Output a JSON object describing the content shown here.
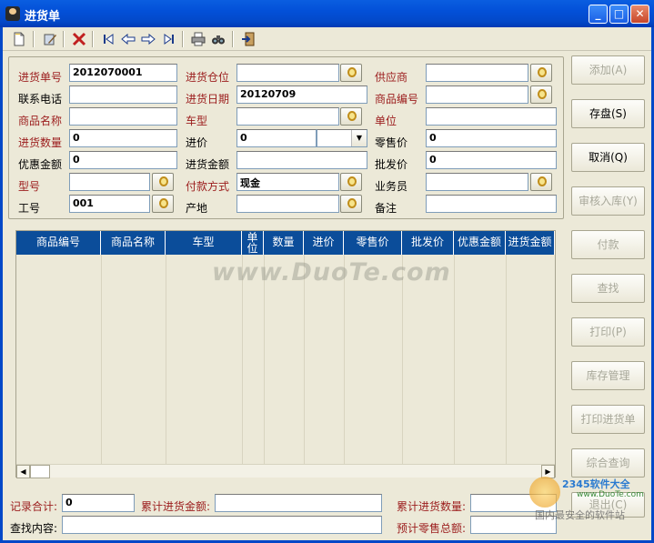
{
  "window": {
    "title": "进货单",
    "minimize": "_",
    "maximize": "□",
    "close": "✕"
  },
  "toolbar": {
    "icons": [
      "new-icon",
      "edit-icon",
      "delete-icon",
      "first-icon",
      "prev-icon",
      "next-icon",
      "last-icon",
      "print-icon",
      "find-icon",
      "exit-icon"
    ]
  },
  "form": {
    "order_no_label": "进货单号",
    "order_no": "2012070001",
    "warehouse_label": "进货仓位",
    "warehouse": "",
    "supplier_label": "供应商",
    "supplier": "",
    "phone_label": "联系电话",
    "phone": "",
    "date_label": "进货日期",
    "date": "20120709",
    "product_code_label": "商品编号",
    "product_code": "",
    "product_name_label": "商品名称",
    "product_name": "",
    "model_label": "车型",
    "model": "",
    "unit_label": "单位",
    "unit": "",
    "qty_label": "进货数量",
    "qty": "0",
    "price_label": "进价",
    "price": "0",
    "retail_label": "零售价",
    "retail": "0",
    "discount_label": "优惠金额",
    "discount": "0",
    "amount_label": "进货金额",
    "amount": "",
    "wholesale_label": "批发价",
    "wholesale": "0",
    "type_label": "型号",
    "type": "",
    "payment_label": "付款方式",
    "payment": "现金",
    "salesman_label": "业务员",
    "salesman": "",
    "worker_label": "工号",
    "worker": "001",
    "origin_label": "产地",
    "origin": "",
    "remark_label": "备注",
    "remark": ""
  },
  "grid": {
    "columns": [
      "商品编号",
      "商品名称",
      "车型",
      "单位",
      "数量",
      "进价",
      "零售价",
      "批发价",
      "优惠金额",
      "进货金额"
    ]
  },
  "actions": {
    "add": "添加(A)",
    "save": "存盘(S)",
    "cancel": "取消(Q)",
    "audit": "审核入库(Y)",
    "pay": "付款",
    "search": "查找",
    "print": "打印(P)",
    "stock": "库存管理",
    "print_order": "打印进货单",
    "query": "综合查询",
    "exit": "退出(C)"
  },
  "footer": {
    "record_total_label": "记录合计:",
    "record_total": "0",
    "amount_total_label": "累计进货金额:",
    "amount_total": "",
    "qty_total_label": "累计进货数量:",
    "qty_total": "",
    "search_label": "查找内容:",
    "search": "",
    "retail_total_label": "预计零售总额:",
    "retail_total": ""
  },
  "watermarks": {
    "main": "www.DuoTe.com",
    "corner1": "2345软件大全",
    "corner2": "www.DuoTe.com",
    "corner3": "国内最安全的软件站"
  },
  "colors": {
    "titlebar": "#0348c8",
    "header": "#0b4d9a",
    "required_label": "#9b1c1c",
    "background": "#ece9d8"
  }
}
